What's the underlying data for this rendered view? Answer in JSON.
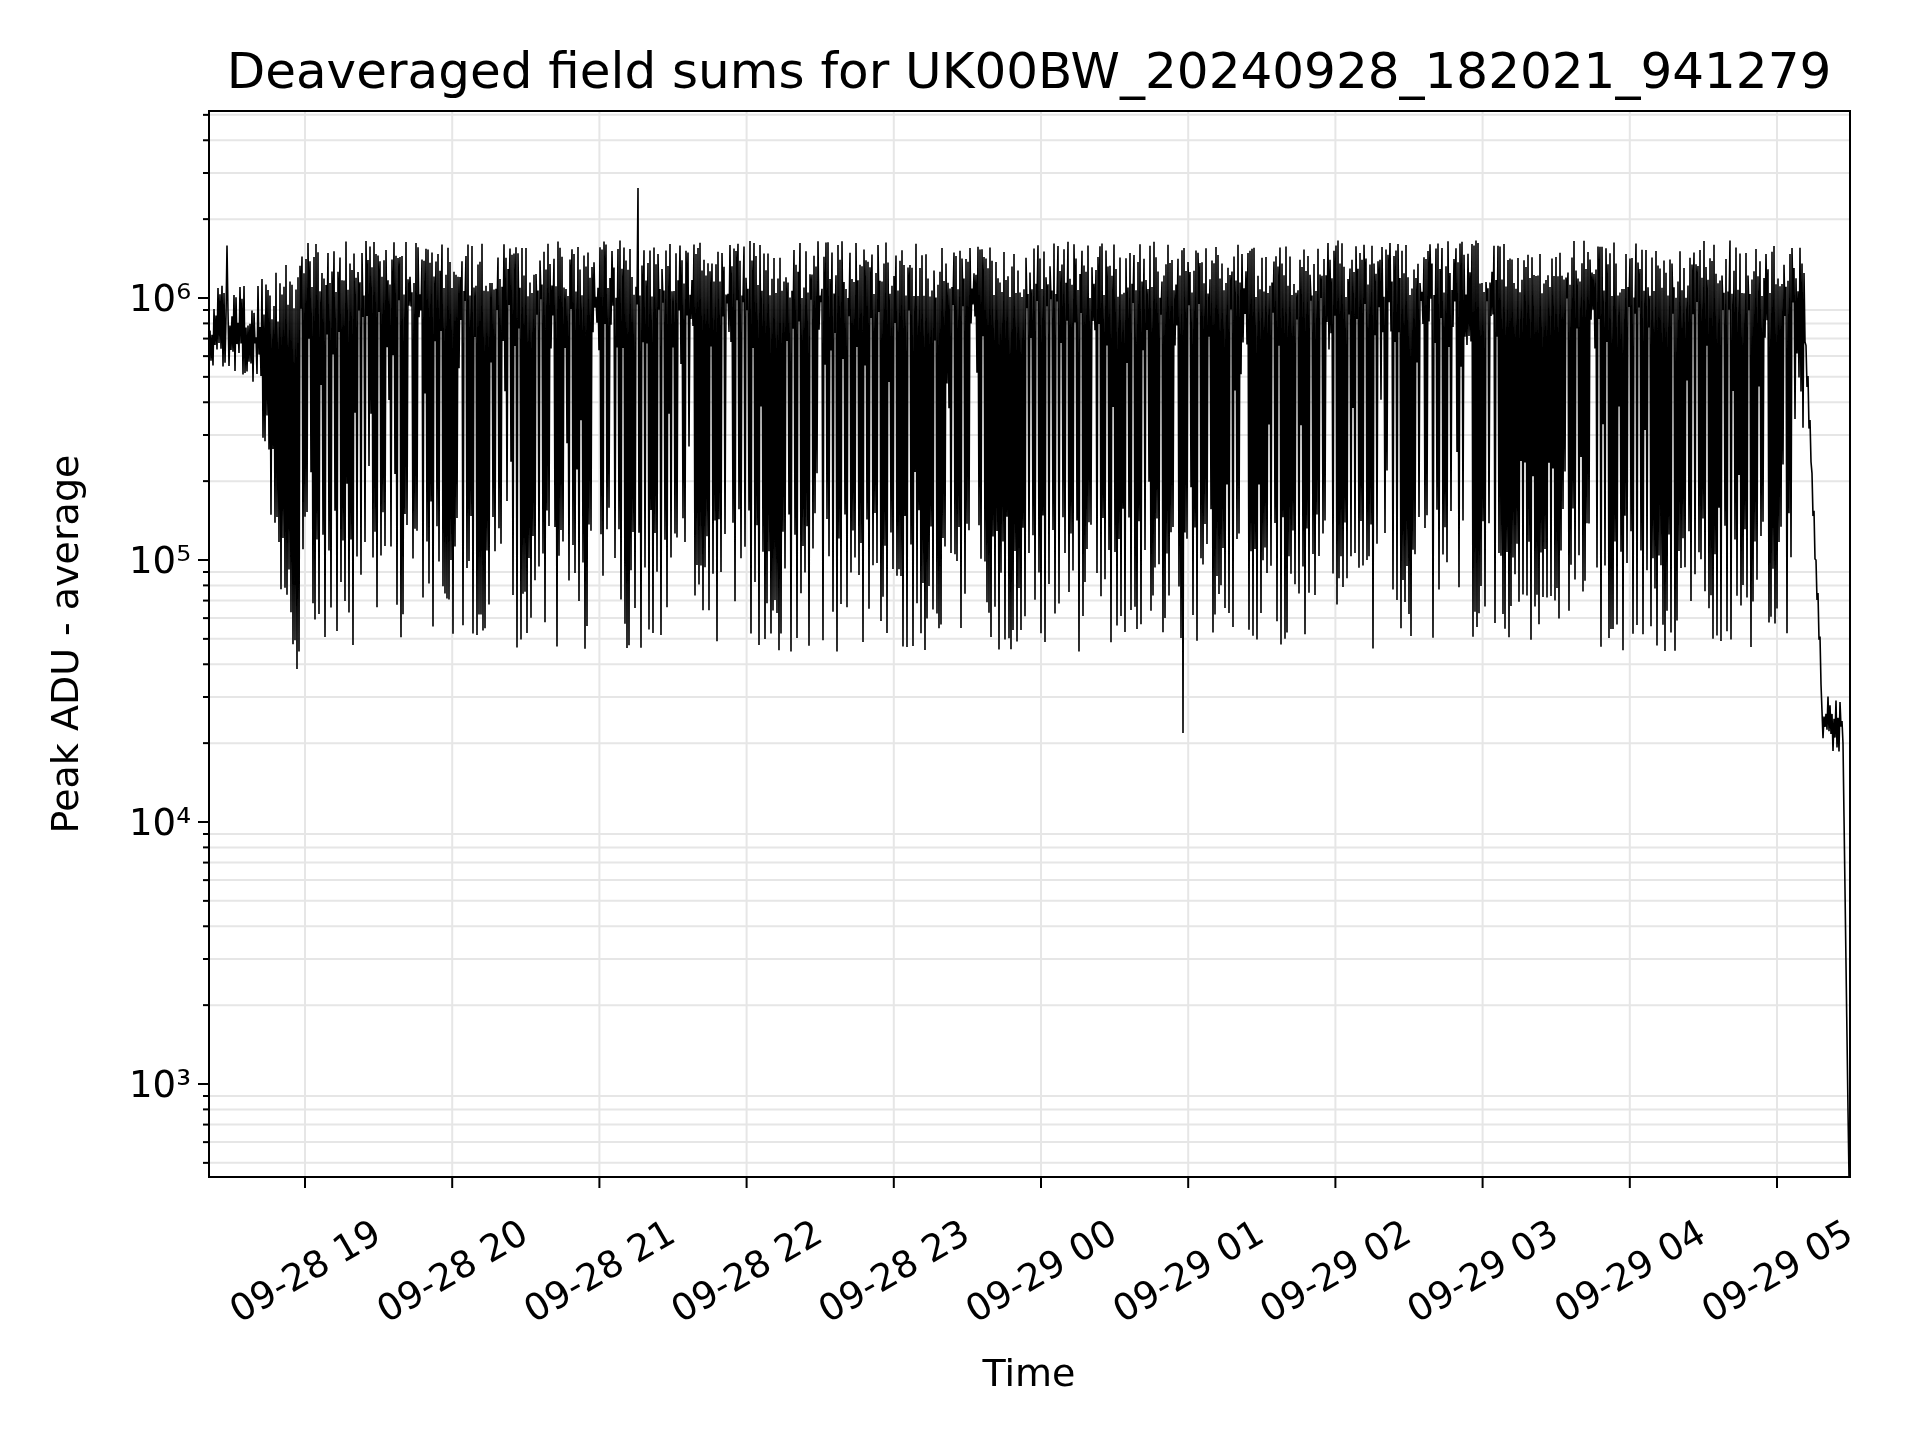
{
  "title": "Deaveraged field sums for UK00BW_20240928_182021_941279",
  "xlabel": "Time",
  "ylabel": "Peak ADU - average",
  "xticks": [
    "09-28 19",
    "09-28 20",
    "09-28 21",
    "09-28 22",
    "09-28 23",
    "09-29 00",
    "09-29 01",
    "09-29 02",
    "09-29 03",
    "09-29 04",
    "09-29 05"
  ],
  "yticks": [
    "10⁶",
    "10⁵",
    "10⁴",
    "10³"
  ]
}
